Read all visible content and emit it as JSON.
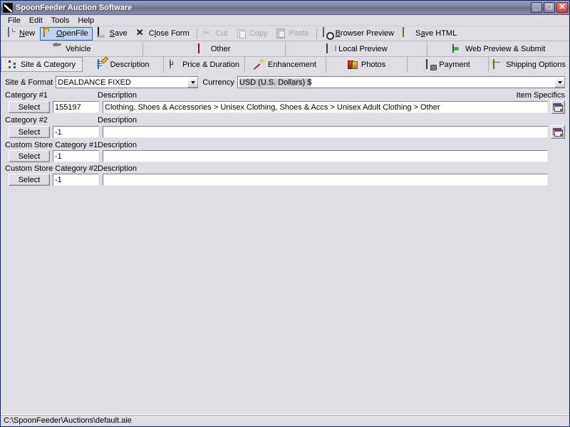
{
  "window": {
    "title": "SpoonFeeder Auction Software",
    "icon": "app-icon",
    "minimize_label": "_",
    "maximize_label": "❐",
    "close_label": "✕"
  },
  "menubar": {
    "items": [
      {
        "label": "File"
      },
      {
        "label": "Edit"
      },
      {
        "label": "Tools"
      },
      {
        "label": "Help"
      }
    ]
  },
  "toolbar": {
    "buttons": [
      {
        "label": "New",
        "icon": "new-document-icon",
        "state": "normal",
        "accel": "N"
      },
      {
        "label": "OpenFile",
        "icon": "open-folder-icon",
        "state": "hot",
        "accel": "O"
      },
      {
        "label": "Save",
        "icon": "floppy-disk-icon",
        "state": "normal",
        "accel": "S"
      },
      {
        "label": "Close Form",
        "icon": "close-x-icon",
        "state": "normal",
        "accel": "l"
      },
      {
        "label": "Cut",
        "icon": "scissors-icon",
        "state": "disabled",
        "accel": ""
      },
      {
        "label": "Copy",
        "icon": "copy-icon",
        "state": "disabled",
        "accel": ""
      },
      {
        "label": "Paste",
        "icon": "clipboard-icon",
        "state": "disabled",
        "accel": ""
      },
      {
        "label": "Browser Preview",
        "icon": "browser-preview-icon",
        "state": "normal",
        "accel": "B"
      },
      {
        "label": "Save HTML",
        "icon": "save-html-icon",
        "state": "normal",
        "accel": "a"
      }
    ]
  },
  "tabs_top": [
    {
      "label": "Vehicle",
      "icon": "car-icon",
      "selected": false
    },
    {
      "label": "Other",
      "icon": "barcode-icon",
      "selected": false
    },
    {
      "label": "Local Preview",
      "icon": "book-icon",
      "selected": false
    },
    {
      "label": "Web Preview & Submit",
      "icon": "globe-icon",
      "selected": false
    }
  ],
  "tabs_bottom": [
    {
      "label": "Site & Category",
      "icon": "site-category-icon",
      "selected": true
    },
    {
      "label": "Description",
      "icon": "description-icon",
      "selected": false
    },
    {
      "label": "Price & Duration",
      "icon": "clock-icon",
      "selected": false
    },
    {
      "label": "Enhancement",
      "icon": "magic-wand-icon",
      "selected": false
    },
    {
      "label": "Photos",
      "icon": "photos-icon",
      "selected": false
    },
    {
      "label": "Payment",
      "icon": "payment-icon",
      "selected": false
    },
    {
      "label": "Shipping Options",
      "icon": "shipping-box-icon",
      "selected": false
    }
  ],
  "form": {
    "site_format": {
      "label": "Site & Format",
      "value": "DEALDANCE FIXED"
    },
    "currency": {
      "label": "Currency",
      "value": "USD (U.S. Dollars) $",
      "selected": true
    },
    "item_specifics_label": "Item Specifics",
    "description_label": "Description",
    "select_button_label": "Select",
    "categories": [
      {
        "label": "Category #1",
        "code": "155197",
        "description": "Clothing, Shoes & Accessories > Unisex Clothing, Shoes & Accs > Unisex Adult Clothing > Other",
        "has_specifics": true
      },
      {
        "label": "Category #2",
        "code": "-1",
        "description": "",
        "has_specifics": true
      },
      {
        "label": "Custom Store Category #1",
        "code": "-1",
        "description": "",
        "has_specifics": false
      },
      {
        "label": "Custom Store Category #2",
        "code": "-1",
        "description": "",
        "has_specifics": false
      }
    ]
  },
  "statusbar": {
    "path": "C:\\SpoonFeeder\\Auctions\\default.aie"
  },
  "colors": {
    "window_background": "#dedde3",
    "titlebar": "#7e7e9e",
    "hot_button_border": "#335ea8",
    "hot_button_fill": "#c1d2ee",
    "close_button": "#c8453c",
    "field_background": "#ffffff",
    "selection": "#c8c7ce"
  }
}
